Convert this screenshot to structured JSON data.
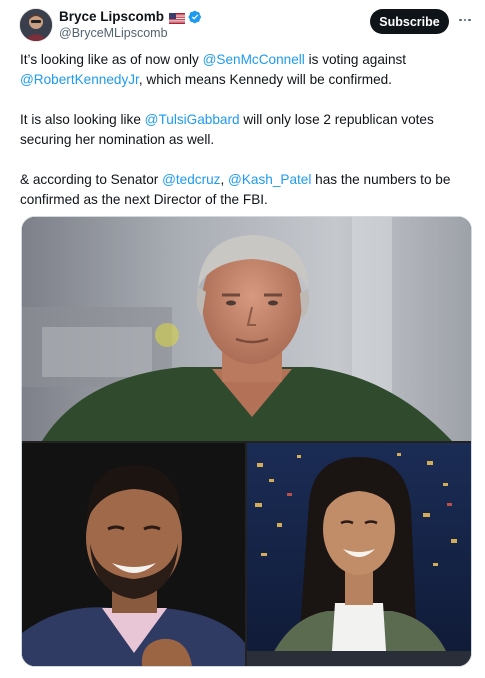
{
  "author": {
    "display_name": "Bryce Lipscomb",
    "handle": "@BryceMLipscomb",
    "flag_icon": "us-flag-icon",
    "verified_icon": "verified-badge-icon",
    "verified_color": "#1d9bf0"
  },
  "actions": {
    "subscribe_label": "Subscribe",
    "more_icon": "more-dots-icon"
  },
  "post": {
    "p1": {
      "t1": "It’s looking like as of now only ",
      "m1": "@SenMcConnell",
      "t2": " is voting against ",
      "m2": "@RobertKennedyJr",
      "t3": ", which means Kennedy will be confirmed."
    },
    "p2": {
      "t1": "It is also looking like ",
      "m1": "@TulsiGabbard",
      "t2": " will only lose 2 republican votes securing her nomination as well."
    },
    "p3": {
      "t1": "& according to Senator ",
      "m1": "@tedcruz",
      "t2": ", ",
      "m2": "@Kash_Patel",
      "t3": " has the numbers to be confirmed as the next Director of the FBI."
    }
  },
  "media": {
    "photos": [
      "photo-1",
      "photo-2",
      "photo-3"
    ]
  },
  "colors": {
    "text": "#0f1419",
    "secondary": "#536471",
    "link": "#1d9bf0",
    "border": "#cfd9de"
  }
}
